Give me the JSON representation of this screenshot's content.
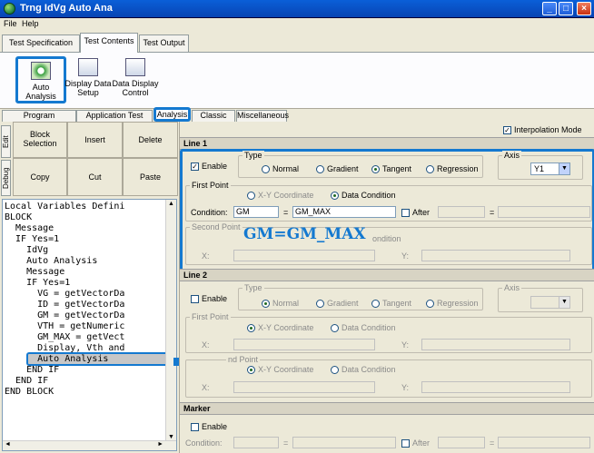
{
  "window": {
    "title": "Trng IdVg Auto Ana"
  },
  "menu": [
    "File",
    "Help"
  ],
  "top_tabs": [
    "Test Specification",
    "Test Contents",
    "Test Output"
  ],
  "toolbar": [
    {
      "label_line1": "Auto",
      "label_line2": "Analysis",
      "icon": "auto-analysis-icon"
    },
    {
      "label_line1": "Display Data",
      "label_line2": "Setup",
      "icon": "display-data-setup-icon"
    },
    {
      "label_line1": "Data Display",
      "label_line2": "Control",
      "icon": "data-display-control-icon"
    }
  ],
  "sub_tabs": [
    "Program Component",
    "Application Test",
    "Analysis",
    "Classic Test",
    "Miscellaneous"
  ],
  "left": {
    "side_tabs": [
      "Edit",
      "Debug"
    ],
    "buttons": [
      "Block Selection",
      "Insert",
      "Delete",
      "Copy",
      "Cut",
      "Paste"
    ],
    "code_lines": [
      "Local Variables Defini",
      "BLOCK",
      "  Message",
      "  IF Yes=1",
      "    IdVg",
      "    Auto Analysis",
      "    Message",
      "    IF Yes=1",
      "      VG = getVectorDa",
      "      ID = getVectorDa",
      "      GM = getVectorDa",
      "      VTH = getNumeric",
      "      GM_MAX = getVect",
      "      Display, Vth and",
      "      Auto Analysis",
      "    END IF",
      "  END IF",
      "END BLOCK"
    ],
    "selected_line_index": 14
  },
  "right": {
    "interpolation_mode": "Interpolation Mode",
    "line1": {
      "header": "Line 1",
      "enable": "Enable",
      "type_title": "Type",
      "types": [
        "Normal",
        "Gradient",
        "Tangent",
        "Regression"
      ],
      "type_selected": "Tangent",
      "axis_title": "Axis",
      "axis_value": "Y1",
      "first_point": "First Point",
      "first_modes": [
        "X-Y Coordinate",
        "Data Condition"
      ],
      "first_mode_selected": "Data Condition",
      "condition_label": "Condition:",
      "condition_left": "GM",
      "equals": "=",
      "condition_right": "GM_MAX",
      "after": "After",
      "second_point": "Second Point",
      "second_mode_fragment": "ondition",
      "x_label": "X:",
      "y_label": "Y:"
    },
    "overlay_text": "GM=GM_MAX",
    "line2": {
      "header": "Line 2",
      "enable": "Enable",
      "type_title": "Type",
      "types": [
        "Normal",
        "Gradient",
        "Tangent",
        "Regression"
      ],
      "axis_title": "Axis",
      "first_point": "First Point",
      "modes": [
        "X-Y Coordinate",
        "Data Condition"
      ],
      "second_point_fragment": "nd Point",
      "x_label": "X:",
      "y_label": "Y:"
    },
    "marker": {
      "header": "Marker",
      "enable": "Enable",
      "condition_label": "Condition:",
      "equals": "=",
      "after": "After"
    }
  },
  "colors": {
    "highlight": "#1479d0",
    "titlebar": "#0a5fd8"
  }
}
